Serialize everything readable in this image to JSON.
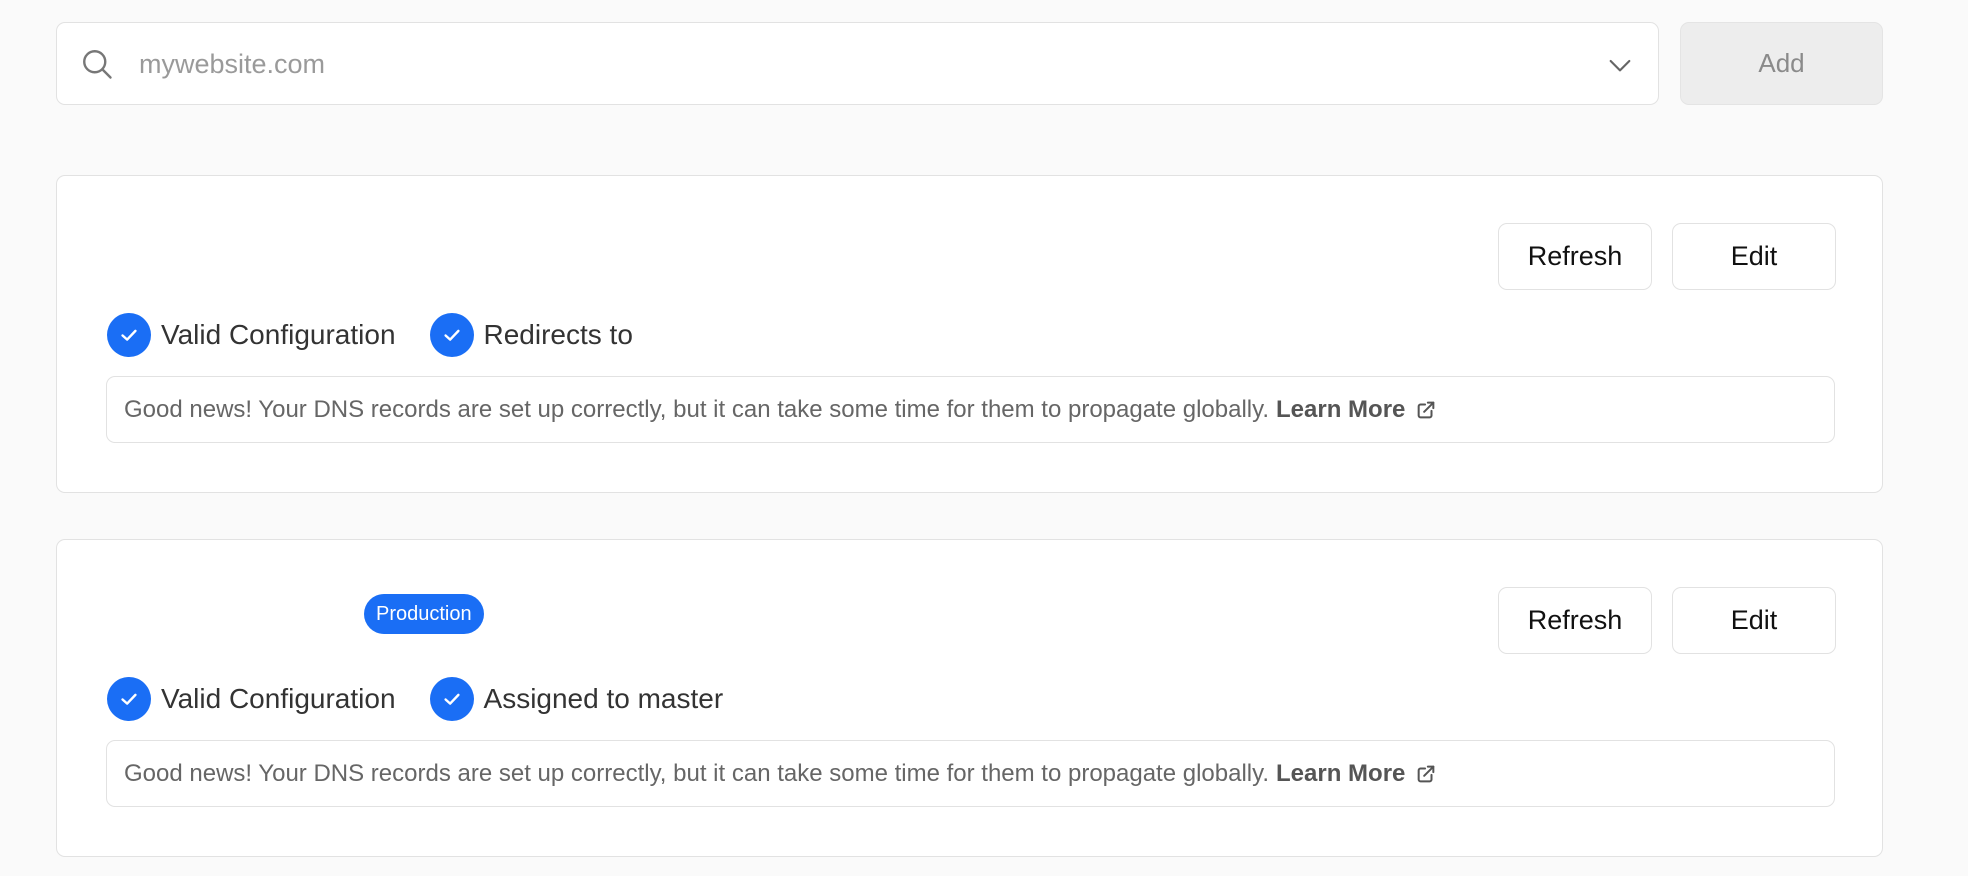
{
  "search": {
    "placeholder": "mywebsite.com",
    "value": ""
  },
  "add_button": {
    "label": "Add"
  },
  "domains": [
    {
      "badge": "",
      "refresh_label": "Refresh",
      "edit_label": "Edit",
      "statuses": [
        {
          "label": "Valid Configuration",
          "icon": "check-circle-icon"
        },
        {
          "label": "Redirects to",
          "icon": "check-circle-icon"
        }
      ],
      "info_text": "Good news! Your DNS records are set up correctly, but it can take some time for them to propagate globally.",
      "learn_more": "Learn More"
    },
    {
      "badge": "Production",
      "refresh_label": "Refresh",
      "edit_label": "Edit",
      "statuses": [
        {
          "label": "Valid Configuration",
          "icon": "check-circle-icon"
        },
        {
          "label": "Assigned to master",
          "icon": "check-circle-icon"
        }
      ],
      "info_text": "Good news! Your DNS records are set up correctly, but it can take some time for them to propagate globally.",
      "learn_more": "Learn More"
    }
  ],
  "colors": {
    "accent": "#1a6ef5",
    "background": "#fafafa",
    "border": "#e2e2e2"
  }
}
